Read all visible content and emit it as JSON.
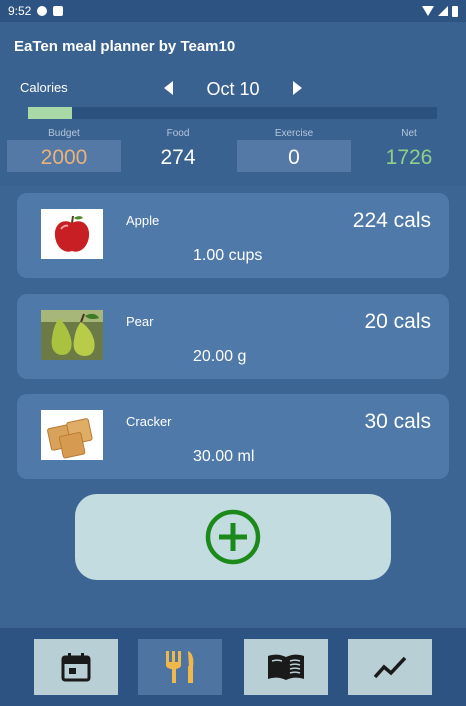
{
  "status_bar": {
    "time": "9:52"
  },
  "app": {
    "title": "EaTen meal planner by Team10"
  },
  "summary": {
    "section_label": "Calories",
    "date": "Oct 10",
    "progress_fraction": 0.107,
    "progress_color": "#a9d9a6",
    "budget": {
      "label": "Budget",
      "value": "2000",
      "color": "#e8b27a"
    },
    "food": {
      "label": "Food",
      "value": "274",
      "color": "#ffffff"
    },
    "exercise": {
      "label": "Exercise",
      "value": "0",
      "color": "#ffffff"
    },
    "net": {
      "label": "Net",
      "value": "1726",
      "color": "#8ed08a"
    }
  },
  "foods": [
    {
      "name": "Apple",
      "calories": "224  cals",
      "quantity": "1.00 cups",
      "icon": "apple-image"
    },
    {
      "name": "Pear",
      "calories": "20  cals",
      "quantity": "20.00 g",
      "icon": "pear-image"
    },
    {
      "name": "Cracker",
      "calories": "30  cals",
      "quantity": "30.00 ml",
      "icon": "cracker-image"
    }
  ],
  "add_button": {
    "icon": "add-circle-icon",
    "color": "#1b8a1b"
  },
  "nav": [
    {
      "icon": "calendar-icon",
      "active": false
    },
    {
      "icon": "fork-knife-icon",
      "active": true
    },
    {
      "icon": "book-icon",
      "active": false
    },
    {
      "icon": "trend-icon",
      "active": false
    }
  ]
}
